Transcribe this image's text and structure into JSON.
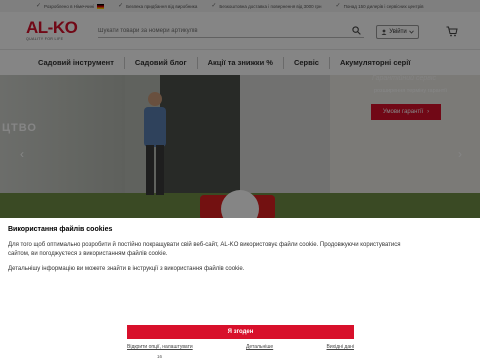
{
  "topbar": {
    "benefits": [
      "Розроблено в Німеччині",
      "Безпека придбання від виробника",
      "Безкоштовна доставка і повернення від 3000 грн",
      "Понад 150 дилерів і сервісних центрів"
    ]
  },
  "header": {
    "logo_text": "AL-KO",
    "logo_tagline": "QUALITY FOR LIFE",
    "search_placeholder": "Шукати товари за номери артикулів",
    "login_label": "Увійти"
  },
  "nav": {
    "items": [
      "Садовий інструмент",
      "Садовий блог",
      "Акції та знижки %",
      "Сервіс",
      "Акумуляторні серії"
    ]
  },
  "hero": {
    "left_text": "ЦТВО",
    "faint_text": "Гарантійний сервіс",
    "subtitle": "розширення терміну гарантії",
    "cta_label": "Умови гарантії"
  },
  "cookie": {
    "title": "Використання файлів cookies",
    "paragraph1": "Для того щоб оптимально розробити й постійно покращувати свій веб-сайт, AL-KO використовує файли cookie. Продовжуючи користуватися сайтом, ви погоджуєтеся з використанням файлів cookie.",
    "paragraph2": "Детальнішу інформацію ви можете знайти в інструкції з використання файлів cookie.",
    "accept_label": "Я згоден",
    "link_settings": "Відкрити опції, налаштувати",
    "link_details": "Детальніше",
    "link_imprint": "Вихідні дані",
    "page_number": "16"
  },
  "colors": {
    "brand_red": "#d8102b"
  }
}
